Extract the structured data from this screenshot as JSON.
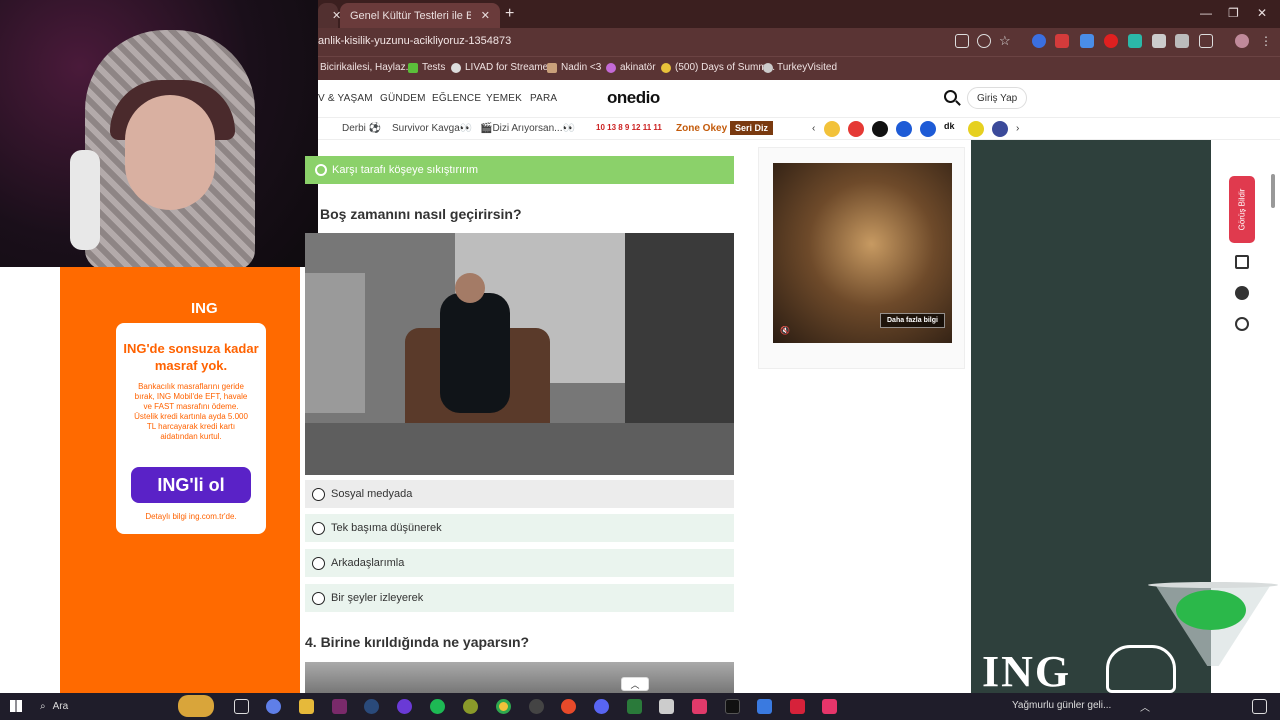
{
  "browser": {
    "tabs": [
      {
        "label": "Genel Kültür Testleri ile Bilgini Sına"
      }
    ],
    "url": "anlik-kisilik-yuzunu-acikliyoruz-1354873",
    "bookmarks": [
      {
        "label": "Bicirikailesi, Haylaz..."
      },
      {
        "label": "Tests"
      },
      {
        "label": "LIVAD for Streamers"
      },
      {
        "label": "Nadin <3"
      },
      {
        "label": "akinatör"
      },
      {
        "label": "(500) Days of Summ..."
      },
      {
        "label": "TurkeyVisited"
      }
    ]
  },
  "site": {
    "logo": "onedio",
    "nav": [
      "V & YAŞAM",
      "GÜNDEM",
      "EĞLENCE",
      "YEMEK",
      "PARA"
    ],
    "login": "Giriş Yap",
    "subnav": [
      "Derbi ⚽",
      "Survivor Kavga👀",
      "🎬Dizi Arıyorsan...👀"
    ],
    "subnav_numbers": "10 13 8 9 12 11 11",
    "zone": "Zone Okey",
    "seri": "Seri Diz"
  },
  "quiz": {
    "previous_selected": "Karşı tarafı köşeye sıkıştırırım",
    "question": "Boş zamanını nasıl geçirirsin?",
    "options": [
      "Sosyal medyada",
      "Tek başıma düşünerek",
      "Arkadaşlarımla",
      "Bir şeyler izleyerek"
    ],
    "next_question": "4. Birine kırıldığında ne yaparsın?"
  },
  "left_ad": {
    "brand": "ING",
    "headline": "ING'de sonsuza kadar masraf yok.",
    "body": "Bankacılık masraflarını geride bırak, ING Mobil'de EFT, havale ve FAST masrafını ödeme. Üstelik kredi kartınla ayda 5.000 TL harcayarak kredi kartı aidatından kurtul.",
    "cta": "ING'li ol",
    "footer": "Detaylı bilgi ing.com.tr'de."
  },
  "right_ad": {
    "more_info": "Daha fazla bilgi",
    "brand": "ING"
  },
  "feedback": "Görüş Bildir",
  "taskbar": {
    "search": "Ara",
    "weather": "Yağmurlu günler geli..."
  },
  "colors": {
    "selected_green": "#8bd16a",
    "ing_orange": "#ff6a00",
    "ing_purple": "#5a22c7",
    "feedback_red": "#e03a4e",
    "dark_panel": "#2e403c"
  }
}
